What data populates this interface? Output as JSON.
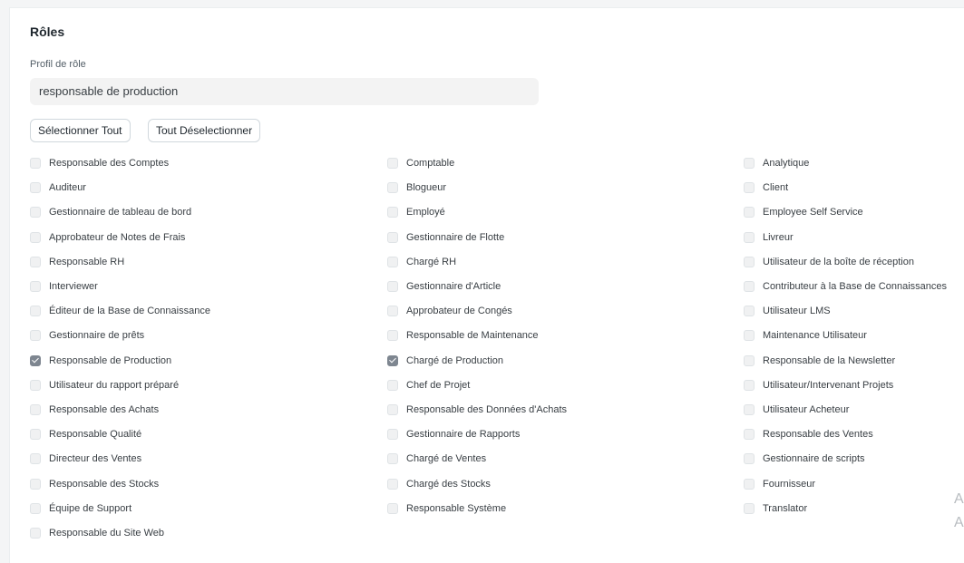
{
  "section": {
    "title": "Rôles"
  },
  "role_profile": {
    "label": "Profil de rôle",
    "value": "responsable de production"
  },
  "buttons": {
    "select_all": "Sélectionner Tout",
    "deselect_all": "Tout Déselectionner"
  },
  "roles": {
    "columns": [
      [
        {
          "label": "Responsable des Comptes",
          "checked": false
        },
        {
          "label": "Auditeur",
          "checked": false
        },
        {
          "label": "Gestionnaire de tableau de bord",
          "checked": false
        },
        {
          "label": "Approbateur de Notes de Frais",
          "checked": false
        },
        {
          "label": "Responsable RH",
          "checked": false
        },
        {
          "label": "Interviewer",
          "checked": false
        },
        {
          "label": "Éditeur de la Base de Connaissance",
          "checked": false
        },
        {
          "label": "Gestionnaire de prêts",
          "checked": false
        },
        {
          "label": "Responsable de Production",
          "checked": true
        },
        {
          "label": "Utilisateur du rapport préparé",
          "checked": false
        },
        {
          "label": "Responsable des Achats",
          "checked": false
        },
        {
          "label": "Responsable Qualité",
          "checked": false
        },
        {
          "label": "Directeur des Ventes",
          "checked": false
        },
        {
          "label": "Responsable des Stocks",
          "checked": false
        },
        {
          "label": "Équipe de Support",
          "checked": false
        },
        {
          "label": "Responsable du Site Web",
          "checked": false
        }
      ],
      [
        {
          "label": "Comptable",
          "checked": false
        },
        {
          "label": "Blogueur",
          "checked": false
        },
        {
          "label": "Employé",
          "checked": false
        },
        {
          "label": "Gestionnaire de Flotte",
          "checked": false
        },
        {
          "label": "Chargé RH",
          "checked": false
        },
        {
          "label": "Gestionnaire d'Article",
          "checked": false
        },
        {
          "label": "Approbateur de Congés",
          "checked": false
        },
        {
          "label": "Responsable de Maintenance",
          "checked": false
        },
        {
          "label": "Chargé de Production",
          "checked": true
        },
        {
          "label": "Chef de Projet",
          "checked": false
        },
        {
          "label": "Responsable des Données d'Achats",
          "checked": false
        },
        {
          "label": "Gestionnaire de Rapports",
          "checked": false
        },
        {
          "label": "Chargé de Ventes",
          "checked": false
        },
        {
          "label": "Chargé des Stocks",
          "checked": false
        },
        {
          "label": "Responsable Système",
          "checked": false
        }
      ],
      [
        {
          "label": "Analytique",
          "checked": false
        },
        {
          "label": "Client",
          "checked": false
        },
        {
          "label": "Employee Self Service",
          "checked": false
        },
        {
          "label": "Livreur",
          "checked": false
        },
        {
          "label": "Utilisateur de la boîte de réception",
          "checked": false
        },
        {
          "label": "Contributeur à la Base de Connaissances",
          "checked": false
        },
        {
          "label": "Utilisateur LMS",
          "checked": false
        },
        {
          "label": "Maintenance Utilisateur",
          "checked": false
        },
        {
          "label": "Responsable de la Newsletter",
          "checked": false
        },
        {
          "label": "Utilisateur/Intervenant Projets",
          "checked": false
        },
        {
          "label": "Utilisateur Acheteur",
          "checked": false
        },
        {
          "label": "Responsable des Ventes",
          "checked": false
        },
        {
          "label": "Gestionnaire de scripts",
          "checked": false
        },
        {
          "label": "Fournisseur",
          "checked": false
        },
        {
          "label": "Translator",
          "checked": false
        }
      ]
    ]
  },
  "watermark": {
    "line1": "A",
    "line2": "A"
  }
}
